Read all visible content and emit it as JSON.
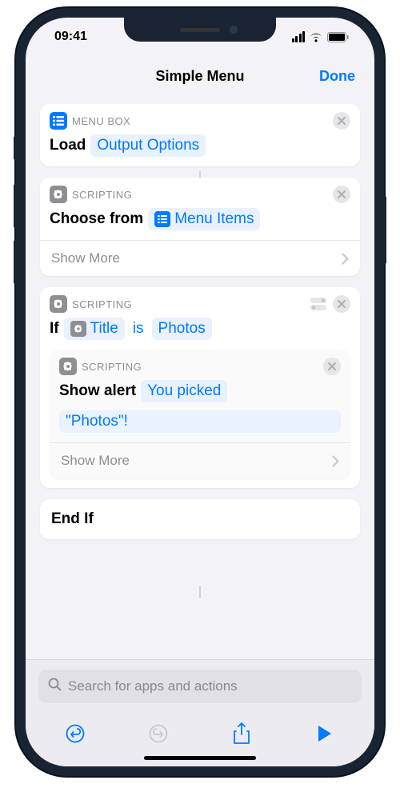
{
  "status": {
    "time": "09:41"
  },
  "nav": {
    "title": "Simple Menu",
    "done": "Done"
  },
  "actions": {
    "a1": {
      "app": "MENU BOX",
      "label": "Load",
      "token": "Output Options"
    },
    "a2": {
      "app": "SCRIPTING",
      "label": "Choose from",
      "token": "Menu Items",
      "showMore": "Show More"
    },
    "a3": {
      "app": "SCRIPTING",
      "label": "If",
      "var": "Title",
      "op": "is",
      "val": "Photos",
      "nested": {
        "app": "SCRIPTING",
        "label": "Show alert",
        "msg1": "You picked",
        "msg2": "\"Photos\"!",
        "showMore": "Show More"
      }
    },
    "endif": "End If"
  },
  "search": {
    "placeholder": "Search for apps and actions"
  }
}
